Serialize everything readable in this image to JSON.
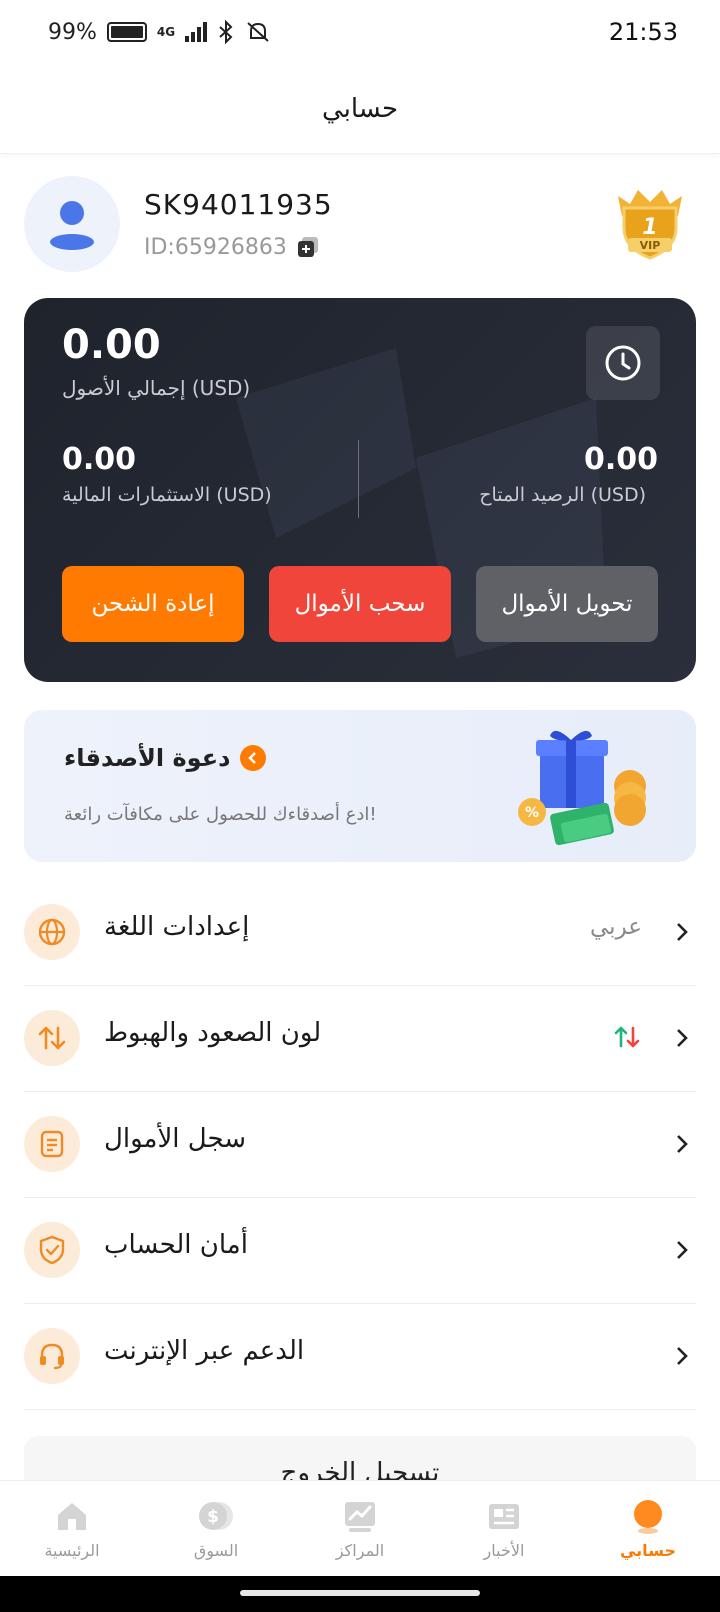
{
  "status_bar": {
    "battery": "99%",
    "network": "4G",
    "time": "21:53"
  },
  "header": {
    "title": "حسابي"
  },
  "profile": {
    "username": "SK94011935",
    "id": "ID:65926863",
    "vip_level": "1",
    "vip_label": "VIP"
  },
  "assets": {
    "total_value": "0.00",
    "total_label": "إجمالي الأصول  (USD)",
    "financial_value": "0.00",
    "financial_label": "الاستثمارات المالية  (USD)",
    "available_value": "0.00",
    "available_label": "الرصيد المتاح  (USD)",
    "buttons": {
      "recharge": "إعادة الشحن",
      "withdraw": "سحب الأموال",
      "transfer": "تحويل الأموال"
    }
  },
  "invite": {
    "title": "دعوة الأصدقاء",
    "subtitle": "ادع أصدقاءك للحصول على مكافآت رائعة!"
  },
  "menu": [
    {
      "label": "إعدادات اللغة",
      "value": "عربي",
      "icon": "globe-icon"
    },
    {
      "label": "لون الصعود والهبوط",
      "value": "",
      "icon": "swap-icon"
    },
    {
      "label": "سجل الأموال",
      "value": "",
      "icon": "document-icon"
    },
    {
      "label": "أمان الحساب",
      "value": "",
      "icon": "shield-check-icon"
    },
    {
      "label": "الدعم عبر الإنترنت",
      "value": "",
      "icon": "headset-icon"
    }
  ],
  "logout_label": "تسجيل الخروج",
  "bottom_nav": [
    {
      "label": "الرئيسية",
      "icon": "home-icon"
    },
    {
      "label": "السوق",
      "icon": "coin-icon"
    },
    {
      "label": "المراكز",
      "icon": "chart-icon"
    },
    {
      "label": "الأخبار",
      "icon": "news-icon"
    },
    {
      "label": "حسابي",
      "icon": "profile-icon",
      "active": true
    }
  ],
  "colors": {
    "accent": "#ff7a00",
    "danger": "#f0453a",
    "card_bg": "#1f232c",
    "up": "#1fb57a",
    "down": "#f0453a"
  }
}
